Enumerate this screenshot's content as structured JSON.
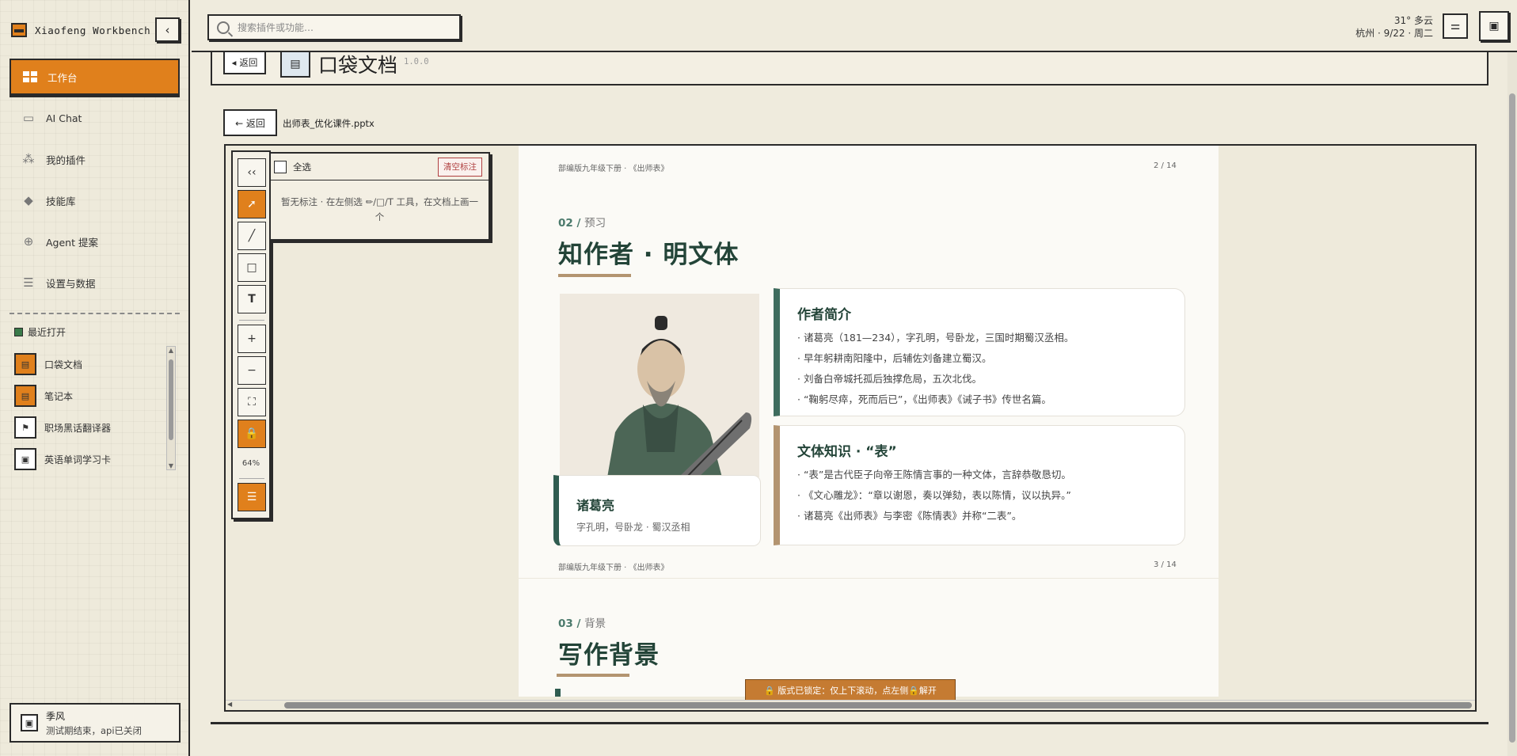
{
  "sidebar": {
    "brand": "Xiaofeng Workbench",
    "collapse_icon": "chevron-left-icon",
    "nav": [
      {
        "label": "工作台",
        "icon": "dashboard-icon",
        "active": true
      },
      {
        "label": "AI Chat",
        "icon": "chat-icon",
        "active": false
      },
      {
        "label": "我的插件",
        "icon": "plugin-icon",
        "active": false
      },
      {
        "label": "技能库",
        "icon": "skill-icon",
        "active": false
      },
      {
        "label": "Agent 提案",
        "icon": "robot-icon",
        "active": false
      },
      {
        "label": "设置与数据",
        "icon": "sliders-icon",
        "active": false
      }
    ],
    "recent_title": "最近打开",
    "recent": [
      {
        "label": "口袋文档",
        "icon": "document-icon"
      },
      {
        "label": "笔记本",
        "icon": "notebook-icon"
      },
      {
        "label": "职场黑话翻译器",
        "icon": "translate-icon"
      },
      {
        "label": "英语单词学习卡",
        "icon": "flashcard-icon"
      }
    ],
    "user": {
      "name": "季风",
      "status": "测试期结束，api已关闭"
    }
  },
  "topbar": {
    "search_placeholder": "搜索插件或功能…",
    "weather_line1": "31° 多云",
    "weather_line2": "杭州 · 9/22 · 周二"
  },
  "app": {
    "back_label": "返回",
    "title": "口袋文档",
    "version": "1.0.0"
  },
  "file": {
    "back_label": "← 返回",
    "name": "出师表_优化课件.pptx"
  },
  "tools": {
    "zoom": "64%"
  },
  "annotations": {
    "select_all": "全选",
    "clear": "清空标注",
    "empty_hint": "暂无标注 · 在左侧选 ✏/□/T 工具，在文档上画一个"
  },
  "slide2": {
    "meta_left": "部编版九年级下册 · 《出师表》",
    "meta_right": "2 / 14",
    "kicker_num": "02 /",
    "kicker_text": "预习",
    "title": "知作者 · 明文体",
    "caption_name": "诸葛亮",
    "caption_sub": "字孔明，号卧龙 · 蜀汉丞相",
    "card1_title": "作者简介",
    "card1_lines": [
      "· 诸葛亮（181—234），字孔明，号卧龙，三国时期蜀汉丞相。",
      "· 早年躬耕南阳隆中，后辅佐刘备建立蜀汉。",
      "· 刘备白帝城托孤后独撑危局，五次北伐。",
      "· “鞠躬尽瘁，死而后已”，《出师表》《诫子书》传世名篇。"
    ],
    "card2_title": "文体知识 · “表”",
    "card2_lines": [
      "· “表”是古代臣子向帝王陈情言事的一种文体，言辞恭敬恳切。",
      "· 《文心雕龙》：“章以谢恩，奏以弹劾，表以陈情，议以执异。”",
      "· 诸葛亮《出师表》与李密《陈情表》并称“二表”。"
    ]
  },
  "slide3": {
    "meta_left": "部编版九年级下册 · 《出师表》",
    "meta_right": "3 / 14",
    "kicker_num": "03 /",
    "kicker_text": "背景",
    "title": "写作背景"
  },
  "lock_notice": "🔒 版式已锁定：仅上下滚动，点左侧🔒解开",
  "colors": {
    "accent": "#e0801c",
    "ink": "#2a2a2a",
    "green": "#234438",
    "tan": "#b39470"
  }
}
